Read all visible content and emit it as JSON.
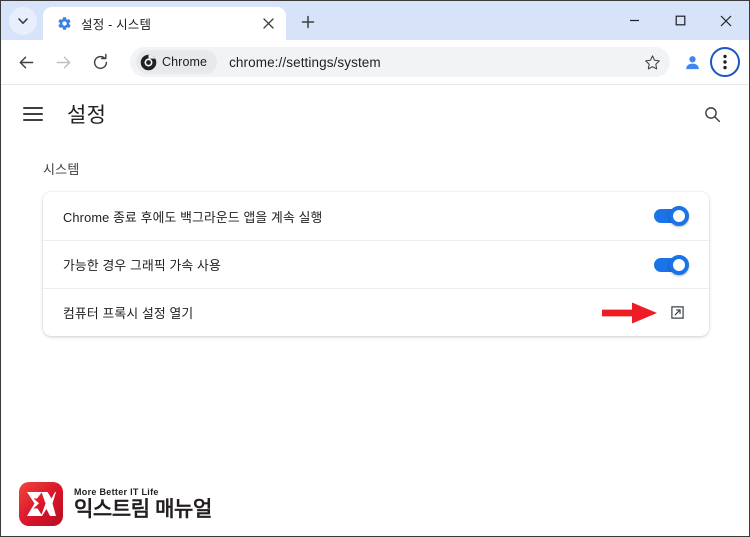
{
  "window": {
    "tab_search_icon": "chevron-down-icon",
    "minimize_label": "—",
    "maximize_label": "□",
    "close_label": "✕"
  },
  "tab": {
    "favicon": "gear-icon",
    "title": "설정 - 시스템",
    "close_icon": "close-icon",
    "new_tab_icon": "plus-icon"
  },
  "toolbar": {
    "back_icon": "arrow-left-icon",
    "forward_icon": "arrow-right-icon",
    "reload_icon": "reload-icon",
    "chip_icon": "chrome-logo-icon",
    "chip_label": "Chrome",
    "url": "chrome://settings/system",
    "star_icon": "star-icon",
    "profile_icon": "account-avatar-icon",
    "menu_icon": "more-vertical-icon"
  },
  "settings": {
    "menu_icon": "hamburger-menu-icon",
    "title": "설정",
    "search_icon": "search-icon",
    "section_label": "시스템",
    "rows": [
      {
        "label": "Chrome 종료 후에도 백그라운드 앱을 계속 실행",
        "control": "toggle",
        "state": "on"
      },
      {
        "label": "가능한 경우 그래픽 가속 사용",
        "control": "toggle",
        "state": "on"
      },
      {
        "label": "컴퓨터 프록시 설정 열기",
        "control": "external-link",
        "state": ""
      }
    ]
  },
  "annotation": {
    "arrow_icon": "red-arrow-right-icon",
    "arrow_color": "#ee1c25"
  },
  "watermark": {
    "mark_text": "EX",
    "tagline": "More Better IT Life",
    "name": "익스트림 매뉴얼",
    "brand_color": "#d8132a"
  },
  "colors": {
    "tabstrip_bg": "#d7e3f9",
    "toggle_on": "#1a73e8",
    "accent": "#1a73e8"
  }
}
